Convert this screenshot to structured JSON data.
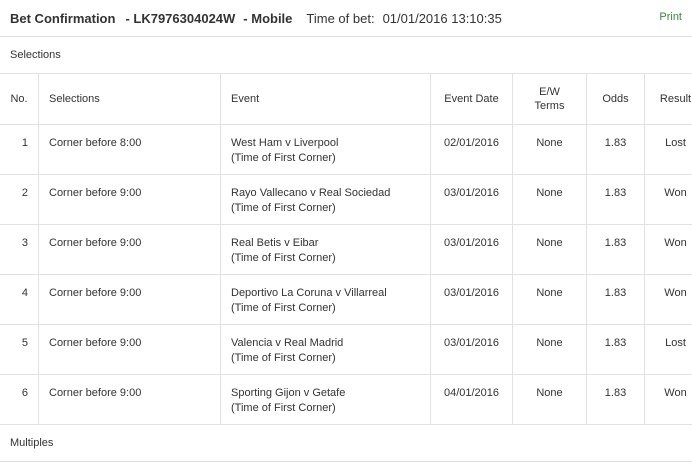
{
  "header": {
    "title": "Bet Confirmation",
    "ref": "- LK7976304024W",
    "channel": "- Mobile",
    "time_label": "Time of bet:",
    "time_value": "01/01/2016 13:10:35",
    "print_label": "Print"
  },
  "selections_label": "Selections",
  "table": {
    "headers": {
      "no": "No.",
      "selections": "Selections",
      "event": "Event",
      "event_date": "Event Date",
      "ew_line1": "E/W",
      "ew_line2": "Terms",
      "odds": "Odds",
      "result": "Result"
    },
    "rows": [
      {
        "no": "1",
        "selection": "Corner before 8:00",
        "event": "West Ham v Liverpool",
        "event_sub": "(Time of First Corner)",
        "date": "02/01/2016",
        "ew": "None",
        "odds": "1.83",
        "result": "Lost"
      },
      {
        "no": "2",
        "selection": "Corner before 9:00",
        "event": "Rayo Vallecano v Real Sociedad",
        "event_sub": "(Time of First Corner)",
        "date": "03/01/2016",
        "ew": "None",
        "odds": "1.83",
        "result": "Won"
      },
      {
        "no": "3",
        "selection": "Corner before 9:00",
        "event": "Real Betis v Eibar",
        "event_sub": "(Time of First Corner)",
        "date": "03/01/2016",
        "ew": "None",
        "odds": "1.83",
        "result": "Won"
      },
      {
        "no": "4",
        "selection": "Corner before 9:00",
        "event": "Deportivo La Coruna v Villarreal",
        "event_sub": "(Time of First Corner)",
        "date": "03/01/2016",
        "ew": "None",
        "odds": "1.83",
        "result": "Won"
      },
      {
        "no": "5",
        "selection": "Corner before 9:00",
        "event": "Valencia v Real Madrid",
        "event_sub": "(Time of First Corner)",
        "date": "03/01/2016",
        "ew": "None",
        "odds": "1.83",
        "result": "Lost"
      },
      {
        "no": "6",
        "selection": "Corner before 9:00",
        "event": "Sporting Gijon v Getafe",
        "event_sub": "(Time of First Corner)",
        "date": "04/01/2016",
        "ew": "None",
        "odds": "1.83",
        "result": "Won"
      }
    ]
  },
  "multiples_label": "Multiples",
  "colors": {
    "link": "#2f8f3a",
    "text": "#333333",
    "border": "#e2e2e2"
  }
}
